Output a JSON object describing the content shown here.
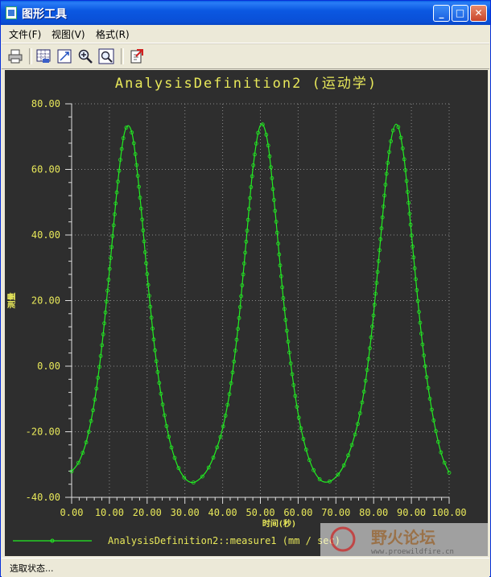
{
  "window": {
    "title": "图形工具"
  },
  "menu": {
    "items": [
      {
        "label": "文件(F)"
      },
      {
        "label": "视图(V)"
      },
      {
        "label": "格式(R)"
      }
    ]
  },
  "status": {
    "text": "选取状态..."
  },
  "watermark": {
    "name": "野火论坛",
    "url": "www.proewildfire.cn"
  },
  "colors": {
    "background": "#2e2e2e",
    "curve": "#22ee22",
    "text": "#e8e85a",
    "grid": "#8a8a8a"
  },
  "chart_data": {
    "type": "line",
    "title": "AnalysisDefinition2 (运动学)",
    "xlabel": "时间(秒)",
    "ylabel": "测量",
    "xlim": [
      0,
      100
    ],
    "ylim": [
      -40,
      80
    ],
    "x_ticks": [
      "0.00",
      "10.00",
      "20.00",
      "30.00",
      "40.00",
      "50.00",
      "60.00",
      "70.00",
      "80.00",
      "90.00",
      "100.00"
    ],
    "y_ticks": [
      "80.00",
      "60.00",
      "40.00",
      "20.00",
      "0.00",
      "-20.00",
      "-40.00"
    ],
    "grid": true,
    "legend_position": "bottom",
    "series": [
      {
        "name": "AnalysisDefinition2::measure1 (mm / sec)",
        "x": [
          0,
          2,
          4,
          6,
          8,
          10,
          12,
          14,
          16,
          18,
          20,
          22,
          24,
          26,
          28,
          30,
          32,
          34,
          36,
          38,
          40,
          42,
          44,
          46,
          48,
          50,
          52,
          54,
          56,
          58,
          60,
          62,
          64,
          66,
          68,
          70,
          72,
          74,
          76,
          78,
          80,
          82,
          84,
          86,
          88,
          90,
          92,
          94,
          96,
          98,
          100
        ],
        "y": [
          -32.1,
          -29.0,
          -22.5,
          -11.2,
          6.0,
          28.8,
          53.5,
          71.2,
          71.0,
          52.8,
          28.0,
          5.5,
          -11.0,
          -22.8,
          -30.2,
          -34.2,
          -35.5,
          -34.3,
          -31.5,
          -26.5,
          -19.0,
          -7.0,
          11.0,
          35.0,
          60.0,
          73.5,
          67.8,
          46.0,
          21.5,
          1.2,
          -14.5,
          -25.0,
          -31.5,
          -34.8,
          -35.3,
          -33.8,
          -30.5,
          -24.8,
          -16.5,
          -3.5,
          16.0,
          41.0,
          64.5,
          73.8,
          64.0,
          40.5,
          16.5,
          -3.0,
          -17.0,
          -27.0,
          -32.5
        ]
      }
    ]
  }
}
